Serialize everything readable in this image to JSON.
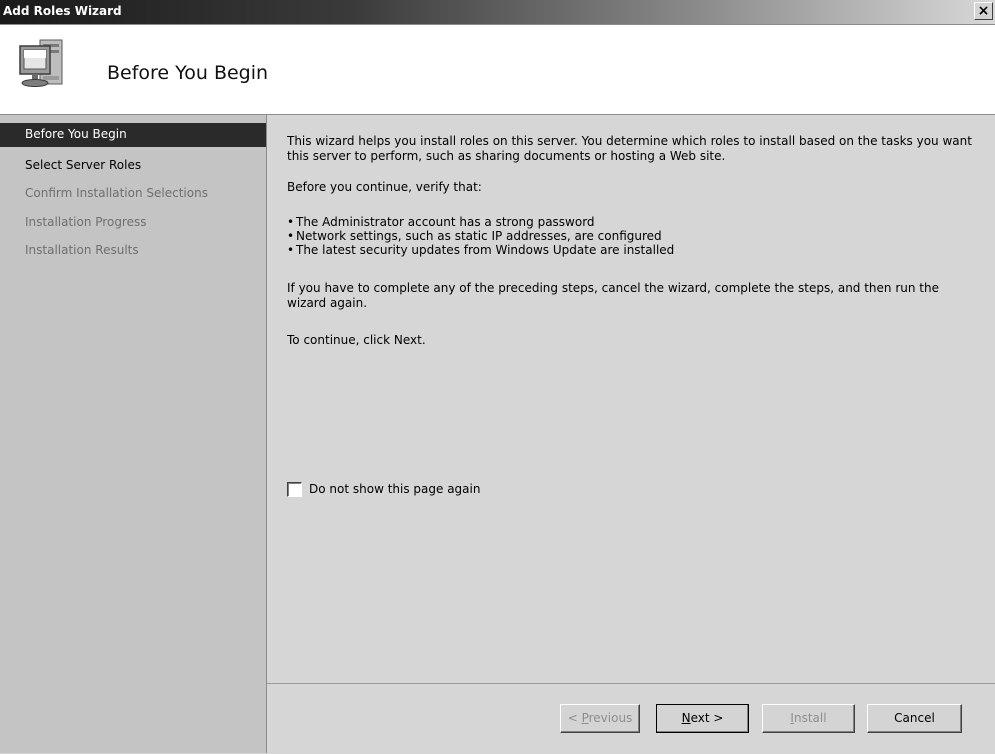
{
  "window": {
    "title": "Add Roles Wizard",
    "close_glyph": "×"
  },
  "header": {
    "title": "Before You Begin",
    "icon": "computer-icon"
  },
  "sidebar": {
    "steps": [
      {
        "label": "Before You Begin",
        "state": "active"
      },
      {
        "label": "Select Server Roles",
        "state": "normal"
      },
      {
        "label": "Confirm Installation Selections",
        "state": "disabled"
      },
      {
        "label": "Installation Progress",
        "state": "disabled"
      },
      {
        "label": "Installation Results",
        "state": "disabled"
      }
    ]
  },
  "content": {
    "intro": "This wizard helps you install roles on this server. You determine which roles to install based on the tasks you want this server to perform, such as sharing documents or hosting a Web site.",
    "verify_heading": "Before you continue, verify that:",
    "bullets": [
      "The Administrator account has a strong password",
      "Network settings, such as static IP addresses, are configured",
      "The latest security updates from Windows Update are installed"
    ],
    "bullet_glyph": "•",
    "cancel_note": "If you have to complete any of the preceding steps, cancel the wizard, complete the steps, and then run the wizard again.",
    "continue_note": "To continue, click Next.",
    "checkbox_label": "Do not show this page again",
    "checkbox_checked": false
  },
  "footer": {
    "previous": {
      "prefix": "< ",
      "accel": "P",
      "rest": "revious",
      "enabled": false
    },
    "next": {
      "accel": "N",
      "rest": "ext >",
      "enabled": true
    },
    "install": {
      "accel": "I",
      "rest": "nstall",
      "enabled": false
    },
    "cancel": {
      "label": "Cancel",
      "enabled": true
    }
  },
  "colors": {
    "active_step_bg": "#2a2a2a",
    "sidebar_bg": "#c4c4c4",
    "content_bg": "#d6d6d6",
    "header_bg": "#ffffff"
  }
}
